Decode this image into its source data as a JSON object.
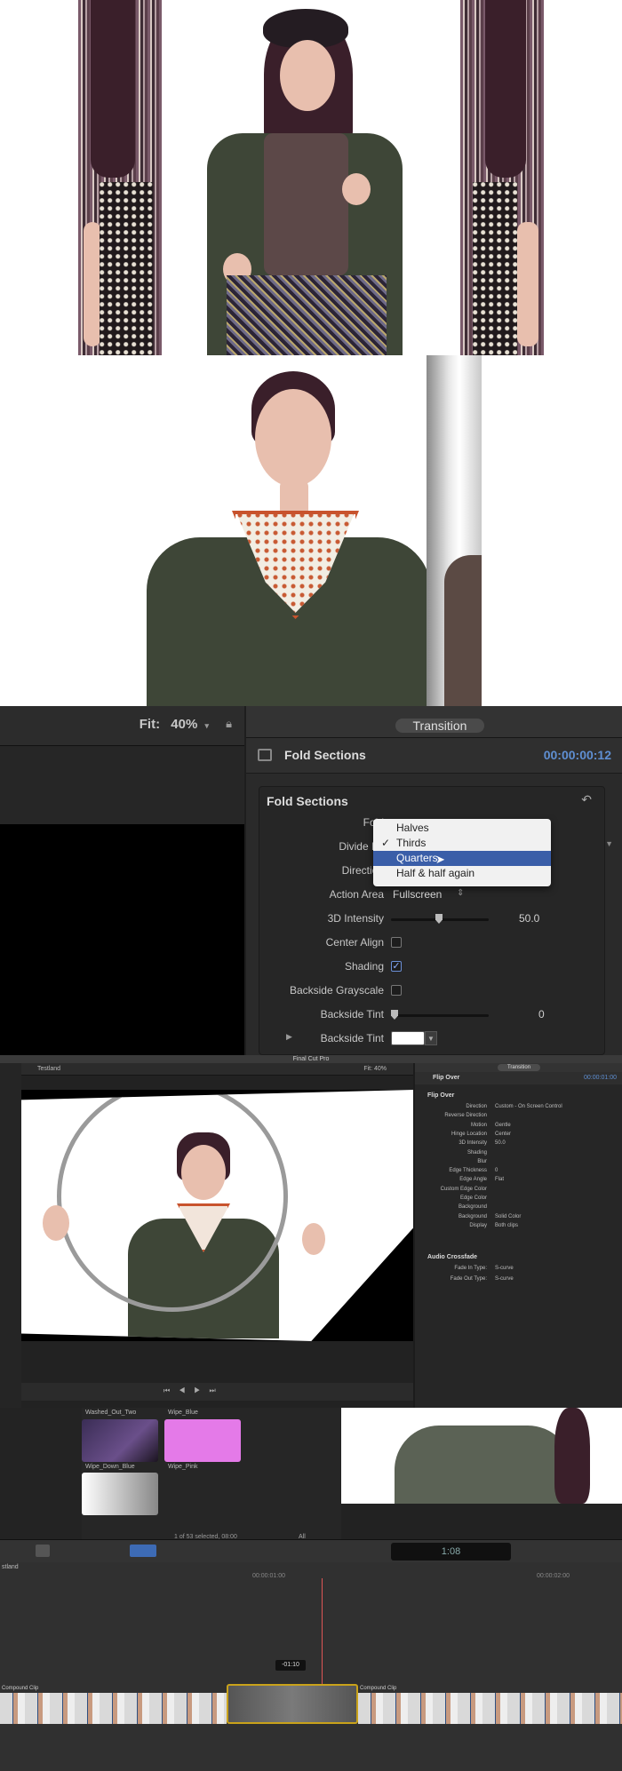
{
  "panel1": {
    "description_colors": {
      "stripe": "#7a5a6a"
    }
  },
  "panel3": {
    "viewer": {
      "fit_label": "Fit:",
      "fit_value": "40%"
    },
    "inspector": {
      "tab": "Transition",
      "title": "Fold Sections",
      "timecode": "00:00:00:12",
      "box_title": "Fold Sections",
      "rows": {
        "fold": {
          "label": "Fold"
        },
        "divide_by": {
          "label": "Divide By"
        },
        "direction": {
          "label": "Direction"
        },
        "action_area": {
          "label": "Action Area",
          "value": "Fullscreen"
        },
        "intensity_3d": {
          "label": "3D Intensity",
          "value": "50.0"
        },
        "center_align": {
          "label": "Center Align"
        },
        "shading": {
          "label": "Shading"
        },
        "backside_grayscale": {
          "label": "Backside Grayscale"
        },
        "backside_tint_amount": {
          "label": "Backside Tint",
          "value": "0"
        },
        "backside_tint_color": {
          "label": "Backside Tint"
        }
      },
      "menu": {
        "items": [
          "Halves",
          "Thirds",
          "Quarters",
          "Half & half again"
        ],
        "checked": "Thirds",
        "highlighted": "Quarters"
      }
    }
  },
  "panel4": {
    "app_title": "Final Cut Pro",
    "viewer": {
      "project": "Testland",
      "fit": "Fit:  40% "
    },
    "inspector": {
      "tab": "Transition",
      "title": "Flip Over",
      "timecode": "00:00:01:00",
      "section": "Flip Over",
      "rows": [
        {
          "label": "Direction",
          "value": "Custom - On Screen Control"
        },
        {
          "label": "Reverse Direction",
          "value": ""
        },
        {
          "label": "Motion",
          "value": "Gentle"
        },
        {
          "label": "Hinge Location",
          "value": "Center"
        },
        {
          "label": "3D Intensity",
          "value": "50.0"
        },
        {
          "label": "Shading",
          "value": ""
        },
        {
          "label": "Blur",
          "value": ""
        },
        {
          "label": "Edge Thickness",
          "value": "0"
        },
        {
          "label": "Edge Angle",
          "value": "Flat"
        },
        {
          "label": "Custom Edge Color",
          "value": ""
        },
        {
          "label": "Edge Color",
          "value": ""
        },
        {
          "label": "Background",
          "value": ""
        },
        {
          "label": "Background",
          "value": "Solid Color"
        },
        {
          "label": "Display",
          "value": "Both clips"
        }
      ],
      "audio_section": "Audio Crossfade",
      "audio_rows": [
        {
          "label": "Fade In Type:",
          "value": "S-curve"
        },
        {
          "label": "Fade Out Type:",
          "value": "S-curve"
        }
      ]
    }
  },
  "panel5": {
    "browser": {
      "items": [
        "Washed_Out_Two",
        "Wipe_Blue",
        "Wipe_Down_Blue",
        "Wipe_Pink"
      ],
      "status": "1 of 53 selected, 08:00",
      "all": "All"
    },
    "toolbar": {
      "timecode": "1:08"
    },
    "timeline": {
      "project": "stland",
      "ruler": [
        "00:00:01:00",
        "00:00:02:00"
      ],
      "offset": "-01:10",
      "clip_left": "Compound Clip",
      "clip_right": "Compound Clip"
    }
  }
}
